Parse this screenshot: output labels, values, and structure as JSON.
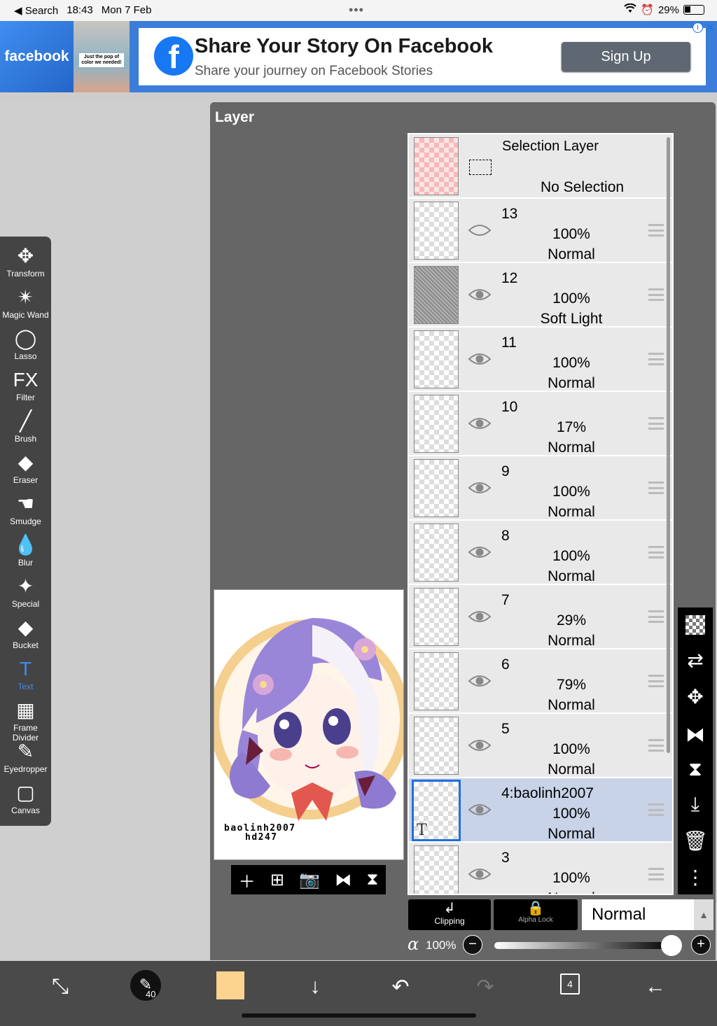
{
  "status": {
    "back_label": "Search",
    "time": "18:43",
    "date": "Mon 7 Feb",
    "battery": "29%",
    "dots": "•••"
  },
  "ad": {
    "brand_tile": "facebook",
    "photo_caption": "Just the pop of color we needed!",
    "title": "Share Your Story On Facebook",
    "subtitle": "Share your journey on Facebook Stories",
    "cta": "Sign Up",
    "info": "i",
    "close": "✕"
  },
  "panel": {
    "title": "Layer"
  },
  "preview": {
    "signature_line1": "baolinh2007",
    "signature_line2": "hd247"
  },
  "selection_layer": {
    "title": "Selection Layer",
    "status": "No Selection"
  },
  "layers": [
    {
      "num": "13",
      "opacity": "100%",
      "mode": "Normal"
    },
    {
      "num": "12",
      "opacity": "100%",
      "mode": "Soft Light"
    },
    {
      "num": "11",
      "opacity": "100%",
      "mode": "Normal"
    },
    {
      "num": "10",
      "opacity": "17%",
      "mode": "Normal"
    },
    {
      "num": "9",
      "opacity": "100%",
      "mode": "Normal"
    },
    {
      "num": "8",
      "opacity": "100%",
      "mode": "Normal"
    },
    {
      "num": "7",
      "opacity": "29%",
      "mode": "Normal"
    },
    {
      "num": "6",
      "opacity": "79%",
      "mode": "Normal"
    },
    {
      "num": "5",
      "opacity": "100%",
      "mode": "Normal"
    },
    {
      "num": "4:baolinh2007",
      "opacity": "100%",
      "mode": "Normal",
      "text_mark": "T"
    },
    {
      "num": "3",
      "opacity": "100%",
      "mode": "Normal"
    }
  ],
  "blend": {
    "clipping": "Clipping",
    "alpha_lock": "Alpha Lock",
    "mode": "Normal",
    "alpha_symbol": "α",
    "alpha_value": "100%"
  },
  "tools": [
    {
      "label": "Transform",
      "icon": "✥"
    },
    {
      "label": "Magic Wand",
      "icon": "✴"
    },
    {
      "label": "Lasso",
      "icon": "◯"
    },
    {
      "label": "Filter",
      "icon": "FX"
    },
    {
      "label": "Brush",
      "icon": "╱"
    },
    {
      "label": "Eraser",
      "icon": "◆"
    },
    {
      "label": "Smudge",
      "icon": "☚"
    },
    {
      "label": "Blur",
      "icon": "💧"
    },
    {
      "label": "Special",
      "icon": "✦"
    },
    {
      "label": "Bucket",
      "icon": "◆"
    },
    {
      "label": "Text",
      "icon": "T"
    },
    {
      "label": "Frame Divider",
      "icon": "▦"
    },
    {
      "label": "Eyedropper",
      "icon": "✎"
    },
    {
      "label": "Canvas",
      "icon": "▢"
    }
  ],
  "bottom": {
    "brush_size": "40",
    "layer_count": "4",
    "color": "#fcd38f"
  }
}
